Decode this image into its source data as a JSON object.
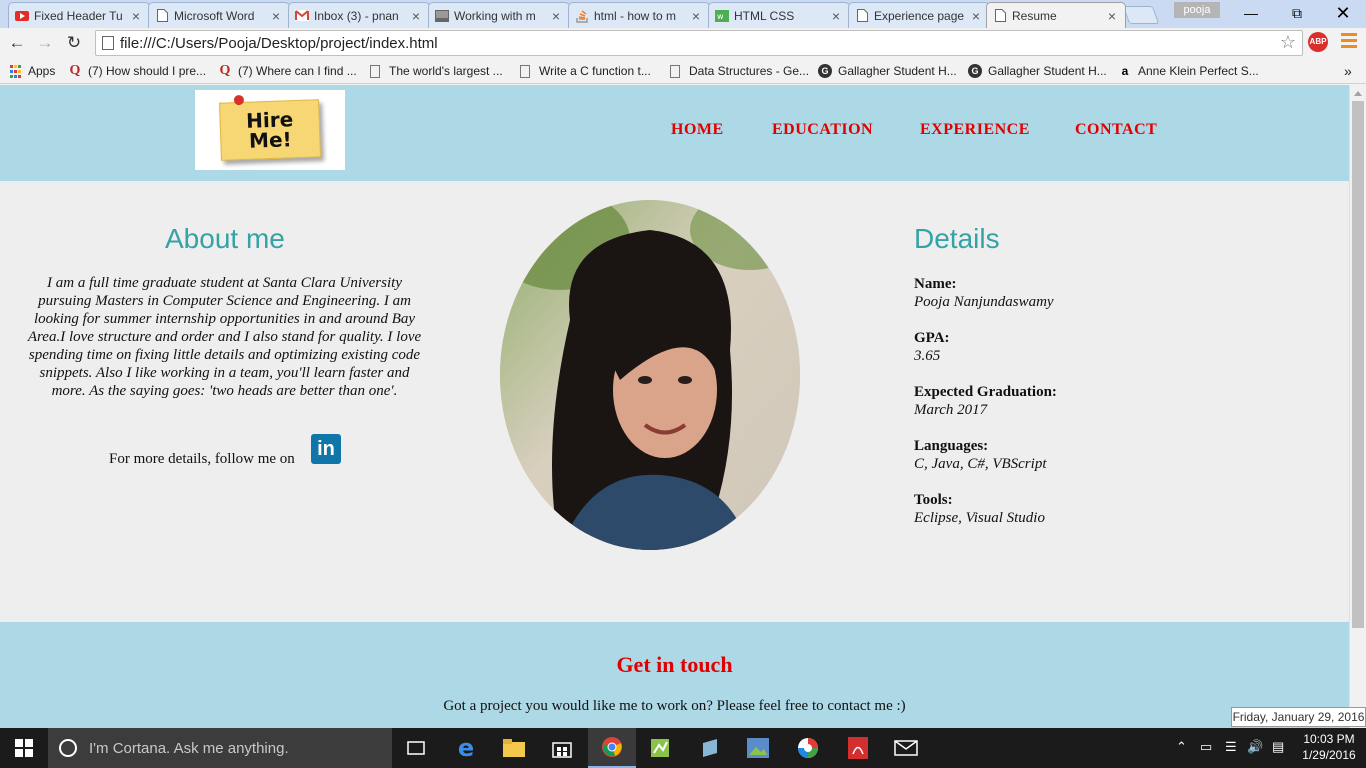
{
  "browser": {
    "tabs": [
      {
        "title": "Fixed Header Tu",
        "icon": "youtube-icon"
      },
      {
        "title": "Microsoft Word",
        "icon": "page-icon"
      },
      {
        "title": "Inbox (3) - pnan",
        "icon": "gmail-icon"
      },
      {
        "title": "Working with m",
        "icon": "page-icon"
      },
      {
        "title": "html - how to m",
        "icon": "stackoverflow-icon"
      },
      {
        "title": "HTML CSS",
        "icon": "page-icon"
      },
      {
        "title": "Experience page",
        "icon": "page-icon"
      },
      {
        "title": "Resume",
        "icon": "page-icon"
      }
    ],
    "profile": "pooja",
    "url": "file:///C:/Users/Pooja/Desktop/project/index.html",
    "abp_label": "ABP",
    "bookmarks": [
      {
        "label": "Apps",
        "icon": "apps-icon"
      },
      {
        "label": "(7) How should I pre...",
        "icon": "quora-icon"
      },
      {
        "label": "(7) Where can I find ...",
        "icon": "quora-icon"
      },
      {
        "label": "The world's largest ...",
        "icon": "page-icon"
      },
      {
        "label": "Write a C function t...",
        "icon": "page-icon"
      },
      {
        "label": "Data Structures - Ge...",
        "icon": "page-icon"
      },
      {
        "label": "Gallagher Student H...",
        "icon": "gallagher-icon"
      },
      {
        "label": "Gallagher Student H...",
        "icon": "gallagher-icon"
      },
      {
        "label": "Anne Klein Perfect S...",
        "icon": "amazon-icon"
      }
    ],
    "bookmarks_overflow": "»"
  },
  "site": {
    "logo": {
      "line1": "Hire",
      "line2": "Me!"
    },
    "nav": [
      "HOME",
      "EDUCATION",
      "EXPERIENCE",
      "CONTACT"
    ],
    "about": {
      "heading": "About me",
      "text": "I am a full time graduate student at Santa Clara University pursuing Masters in Computer Science and Engineering. I am looking for summer internship opportunities in and around Bay Area.I love structure and order and I also stand for quality. I love spending time on fixing little details and optimizing existing code snippets. Also I like working in a team, you'll learn faster and more. As the saying goes: 'two heads are better than one'.",
      "follow": "For more details, follow me on",
      "linkedin": "in"
    },
    "details": {
      "heading": "Details",
      "items": [
        {
          "label": "Name:",
          "value": "Pooja Nanjundaswamy"
        },
        {
          "label": "GPA:",
          "value": "3.65"
        },
        {
          "label": "Expected Graduation:",
          "value": "March 2017"
        },
        {
          "label": "Languages:",
          "value": "C, Java, C#, VBScript"
        },
        {
          "label": "Tools:",
          "value": "Eclipse, Visual Studio"
        }
      ]
    },
    "contact": {
      "heading": "Get in touch",
      "text": "Got a project you would like me to work on? Please feel free to contact me :)"
    }
  },
  "tooltip": "Friday, January 29, 2016",
  "taskbar": {
    "cortana": "I'm Cortana. Ask me anything.",
    "time": "10:03 PM",
    "date": "1/29/2016"
  }
}
